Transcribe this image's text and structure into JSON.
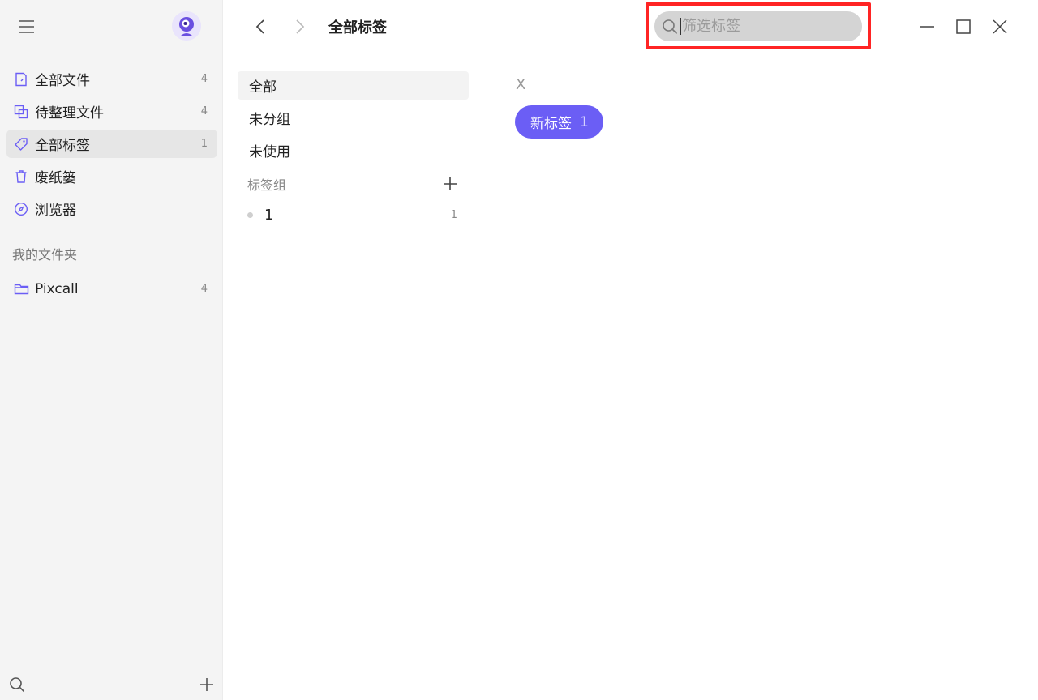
{
  "sidebar": {
    "items": [
      {
        "label": "全部文件",
        "count": "4",
        "icon": "file-icon"
      },
      {
        "label": "待整理文件",
        "count": "4",
        "icon": "unsorted-files-icon"
      },
      {
        "label": "全部标签",
        "count": "1",
        "icon": "tag-icon"
      },
      {
        "label": "废纸篓",
        "count": "",
        "icon": "trash-icon"
      },
      {
        "label": "浏览器",
        "count": "",
        "icon": "compass-icon"
      }
    ],
    "folders_title": "我的文件夹",
    "folders": [
      {
        "label": "Pixcall",
        "count": "4",
        "icon": "folder-icon"
      }
    ]
  },
  "topbar": {
    "title": "全部标签",
    "search_placeholder": "筛选标签"
  },
  "tagpanel": {
    "filters": [
      "全部",
      "未分组",
      "未使用"
    ],
    "group_section_label": "标签组",
    "groups": [
      {
        "label": "1",
        "count": "1"
      }
    ]
  },
  "content": {
    "letter": "X",
    "tags": [
      {
        "label": "新标签",
        "count": "1"
      }
    ]
  },
  "colors": {
    "accent": "#6b5ef5",
    "highlight": "#ff2424",
    "sidebar_bg": "#f4f4f4"
  }
}
